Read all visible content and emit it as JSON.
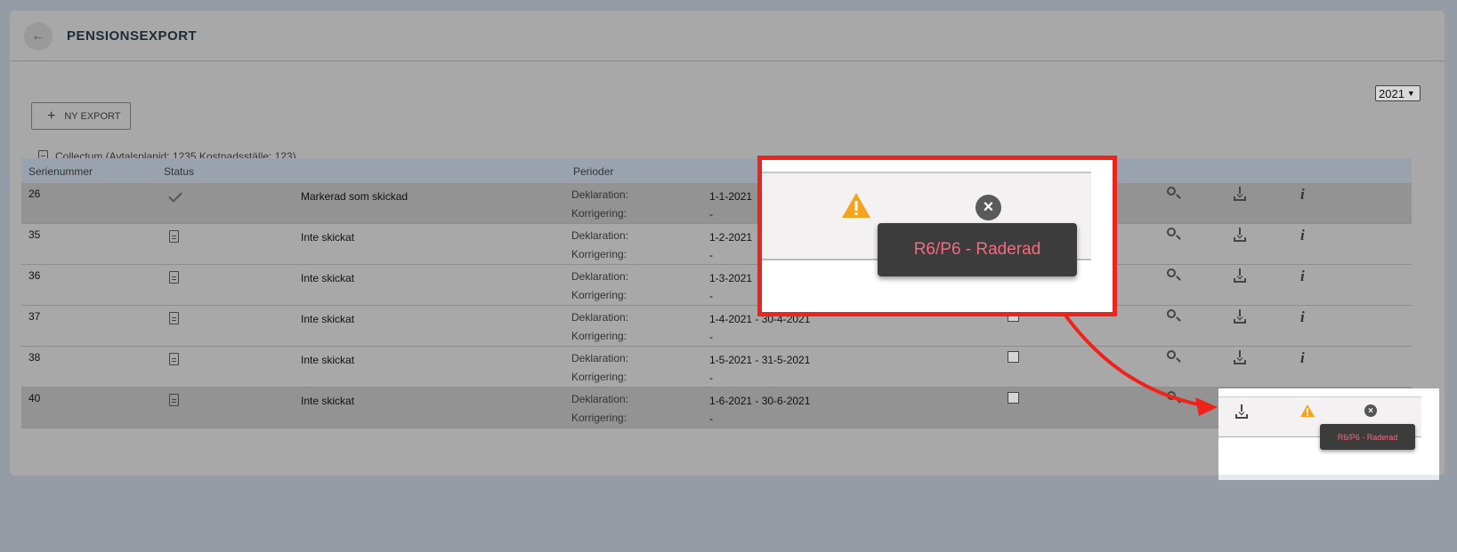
{
  "header": {
    "title": "PENSIONSEXPORT",
    "back_icon": "arrow-left-icon"
  },
  "year_select": {
    "value": "2021"
  },
  "toolbar": {
    "new_export_label": "NY EXPORT"
  },
  "group": {
    "label": "Collectum (Avtalsplanid: 1235,Kostnadsställe: 123)"
  },
  "table": {
    "columns": [
      "Serienummer",
      "Status",
      "Perioder"
    ],
    "rows": [
      {
        "serial": "26",
        "status_icon": "check-icon",
        "status": "Markerad som skickad",
        "decl_label": "Deklaration:",
        "decl": "1-1-2021",
        "corr_label": "Korrigering:",
        "corr": "-"
      },
      {
        "serial": "35",
        "status_icon": "document-icon",
        "status": "Inte skickat",
        "decl_label": "Deklaration:",
        "decl": "1-2-2021",
        "corr_label": "Korrigering:",
        "corr": "-"
      },
      {
        "serial": "36",
        "status_icon": "document-icon",
        "status": "Inte skickat",
        "decl_label": "Deklaration:",
        "decl": "1-3-2021",
        "corr_label": "Korrigering:",
        "corr": "-"
      },
      {
        "serial": "37",
        "status_icon": "document-icon",
        "status": "Inte skickat",
        "decl_label": "Deklaration:",
        "decl": "1-4-2021 - 30-4-2021",
        "corr_label": "Korrigering:",
        "corr": "-"
      },
      {
        "serial": "38",
        "status_icon": "document-icon",
        "status": "Inte skickat",
        "decl_label": "Deklaration:",
        "decl": "1-5-2021 - 31-5-2021",
        "corr_label": "Korrigering:",
        "corr": "-"
      },
      {
        "serial": "40",
        "status_icon": "document-icon",
        "status": "Inte skickat",
        "decl_label": "Deklaration:",
        "decl": "1-6-2021 - 30-6-2021",
        "corr_label": "Korrigering:",
        "corr": "-"
      }
    ]
  },
  "callout": {
    "tooltip": "R6/P6 - Raderad"
  },
  "colors": {
    "accent_red": "#f0221c",
    "warning": "#f7a21b",
    "tooltip_text": "#f26b7f"
  }
}
